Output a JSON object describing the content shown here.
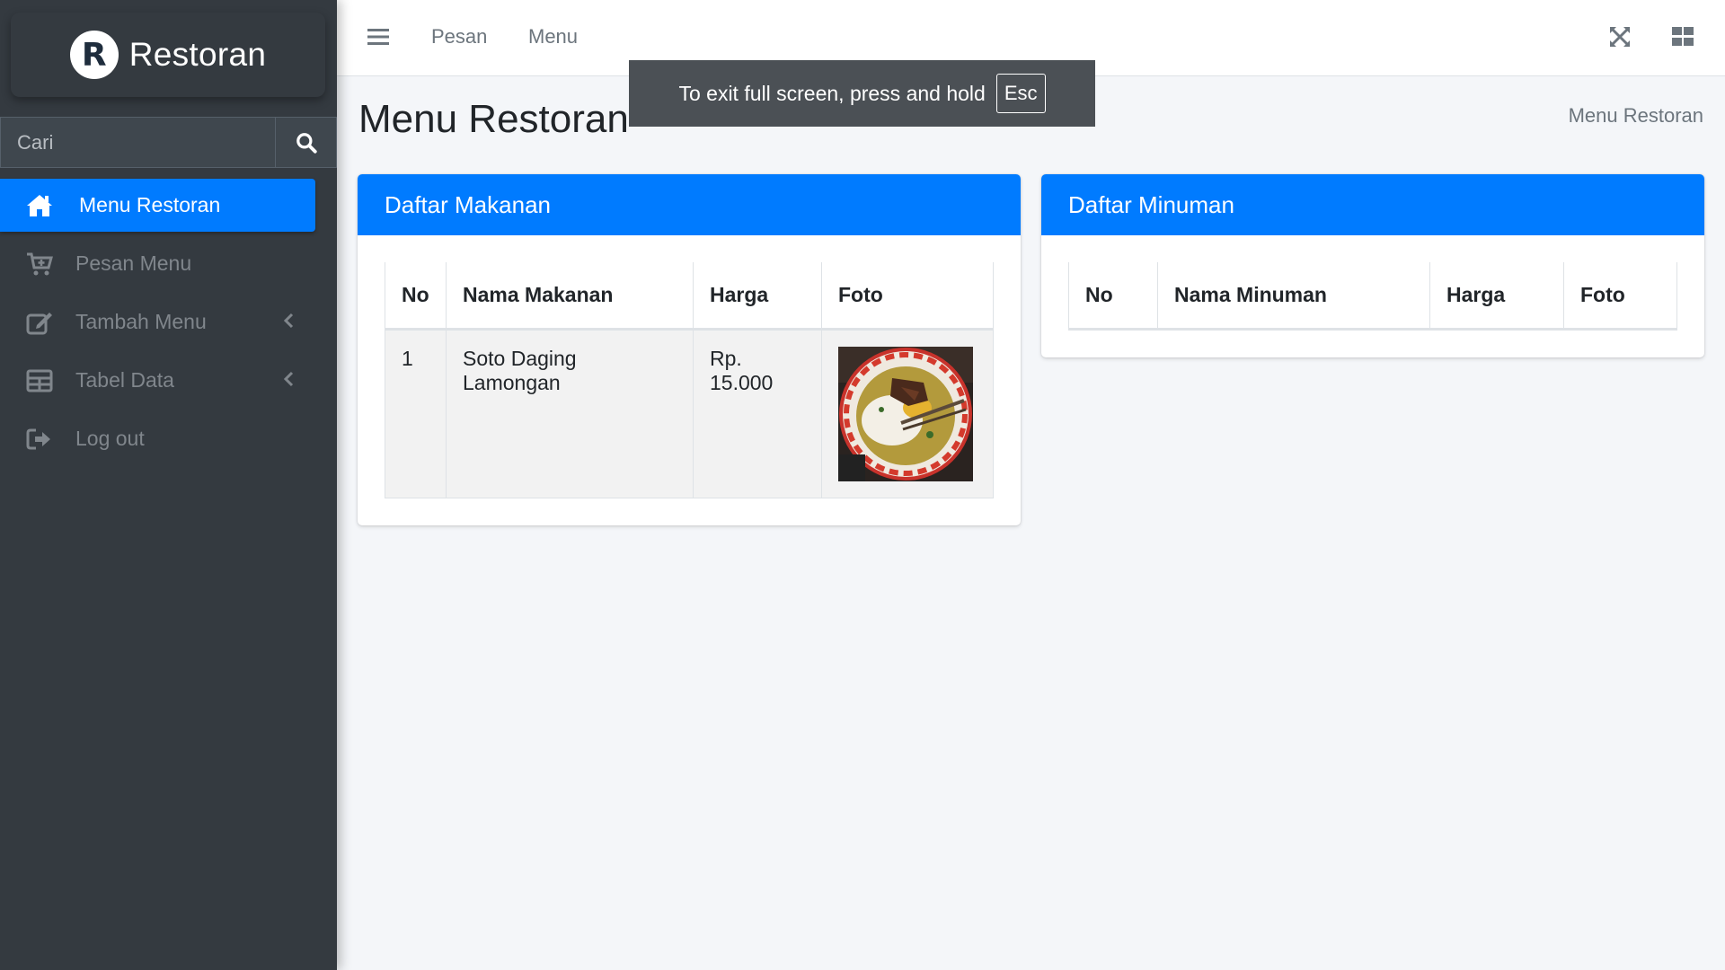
{
  "brand": {
    "logo_letter": "R",
    "name": "Restoran"
  },
  "search": {
    "placeholder": "Cari"
  },
  "sidebar": {
    "items": [
      {
        "label": "Menu Restoran",
        "icon": "home-icon",
        "active": true
      },
      {
        "label": "Pesan Menu",
        "icon": "cart-plus-icon"
      },
      {
        "label": "Tambah Menu",
        "icon": "edit-icon",
        "has_caret": true
      },
      {
        "label": "Tabel Data",
        "icon": "table-icon",
        "has_caret": true
      },
      {
        "label": "Log out",
        "icon": "sign-out-icon"
      }
    ]
  },
  "topbar": {
    "links": [
      "Pesan",
      "Menu"
    ],
    "icons": [
      "hamburger-icon",
      "fullscreen-icon",
      "grid-icon"
    ]
  },
  "fullscreen_notice": {
    "text": "To exit full screen, press and hold",
    "key": "Esc"
  },
  "page": {
    "title": "Menu Restoran",
    "breadcrumb": "Menu Restoran"
  },
  "colors": {
    "primary": "#007bff",
    "sidebar": "#343a40",
    "background": "#f4f6f9"
  },
  "makanan": {
    "title": "Daftar Makanan",
    "headers": [
      "No",
      "Nama Makanan",
      "Harga",
      "Foto"
    ],
    "rows": [
      {
        "no": "1",
        "nama": "Soto Daging Lamongan",
        "harga": "Rp. 15.000",
        "foto": "soto-photo"
      }
    ]
  },
  "minuman": {
    "title": "Daftar Minuman",
    "headers": [
      "No",
      "Nama Minuman",
      "Harga",
      "Foto"
    ],
    "rows": []
  }
}
